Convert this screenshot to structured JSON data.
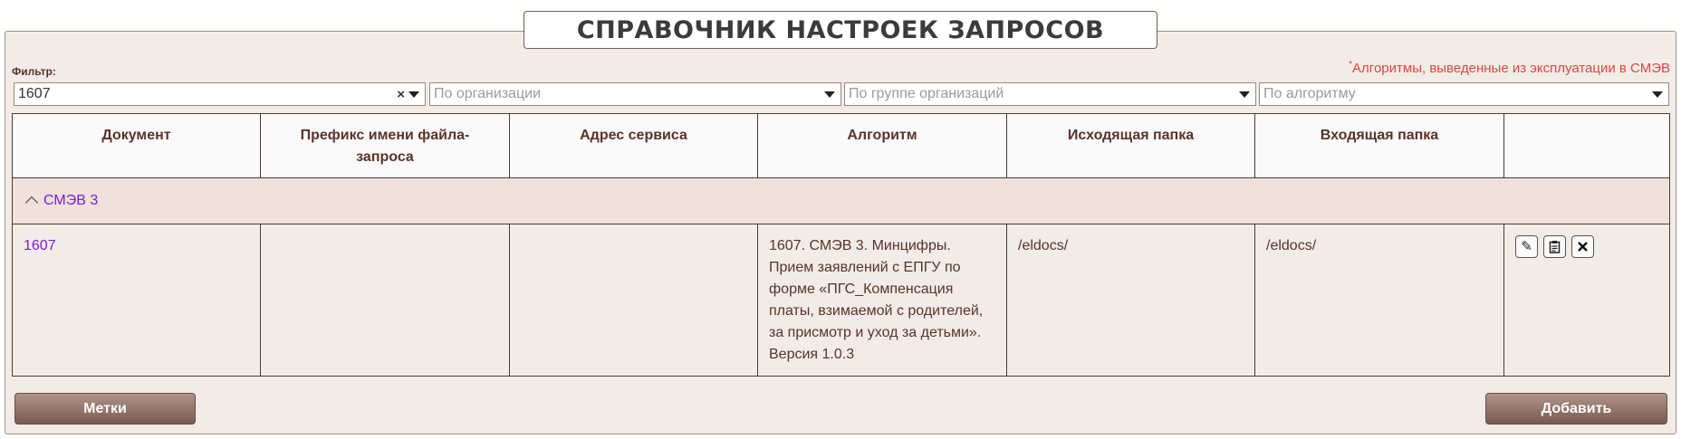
{
  "title": "СПРАВОЧНИК НАСТРОЕК ЗАПРОСОВ",
  "filter": {
    "label": "Фильтр:",
    "note_star": "*",
    "note": "Алгоритмы, выведенные из эксплуатации в СМЭВ",
    "search_value": "1607",
    "clear_symbol": "×",
    "org_placeholder": "По организации",
    "group_placeholder": "По группе организаций",
    "algo_placeholder": "По алгоритму"
  },
  "table": {
    "columns": [
      "Документ",
      "Префикс имени файла-запроса",
      "Адрес сервиса",
      "Алгоритм",
      "Исходящая папка",
      "Входящая папка",
      ""
    ],
    "group": {
      "name": "СМЭВ 3"
    },
    "rows": [
      {
        "document": "1607",
        "prefix": "",
        "service": "",
        "algorithm": "1607. СМЭВ 3. Минцифры. Прием заявлений с ЕПГУ по форме «ПГС_Компенсация платы, взимаемой с родителей, за присмотр и уход за детьми». Версия 1.0.3",
        "out_folder": "/eldocs/",
        "in_folder": "/eldocs/"
      }
    ]
  },
  "buttons": {
    "tags": "Метки",
    "add": "Добавить"
  },
  "icons": {
    "edit": "pencil-icon",
    "copy": "clipboard-icon",
    "delete": "close-icon"
  }
}
